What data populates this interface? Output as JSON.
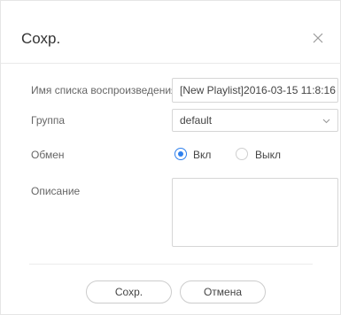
{
  "dialog": {
    "title": "Сохр.",
    "close_icon": "close-icon"
  },
  "form": {
    "playlist_name": {
      "label": "Имя списка воспроизведения",
      "value": "[New Playlist]2016-03-15 11:8:16"
    },
    "group": {
      "label": "Группа",
      "selected": "default",
      "icon": "chevron-down-icon"
    },
    "sharing": {
      "label": "Обмен",
      "options": [
        {
          "label": "Вкл",
          "checked": true
        },
        {
          "label": "Выкл",
          "checked": false
        }
      ]
    },
    "description": {
      "label": "Описание",
      "value": ""
    }
  },
  "footer": {
    "save_label": "Сохр.",
    "cancel_label": "Отмена"
  },
  "colors": {
    "accent": "#2f80ed",
    "border": "#d6d6d6",
    "text": "#444444",
    "label": "#666666"
  }
}
